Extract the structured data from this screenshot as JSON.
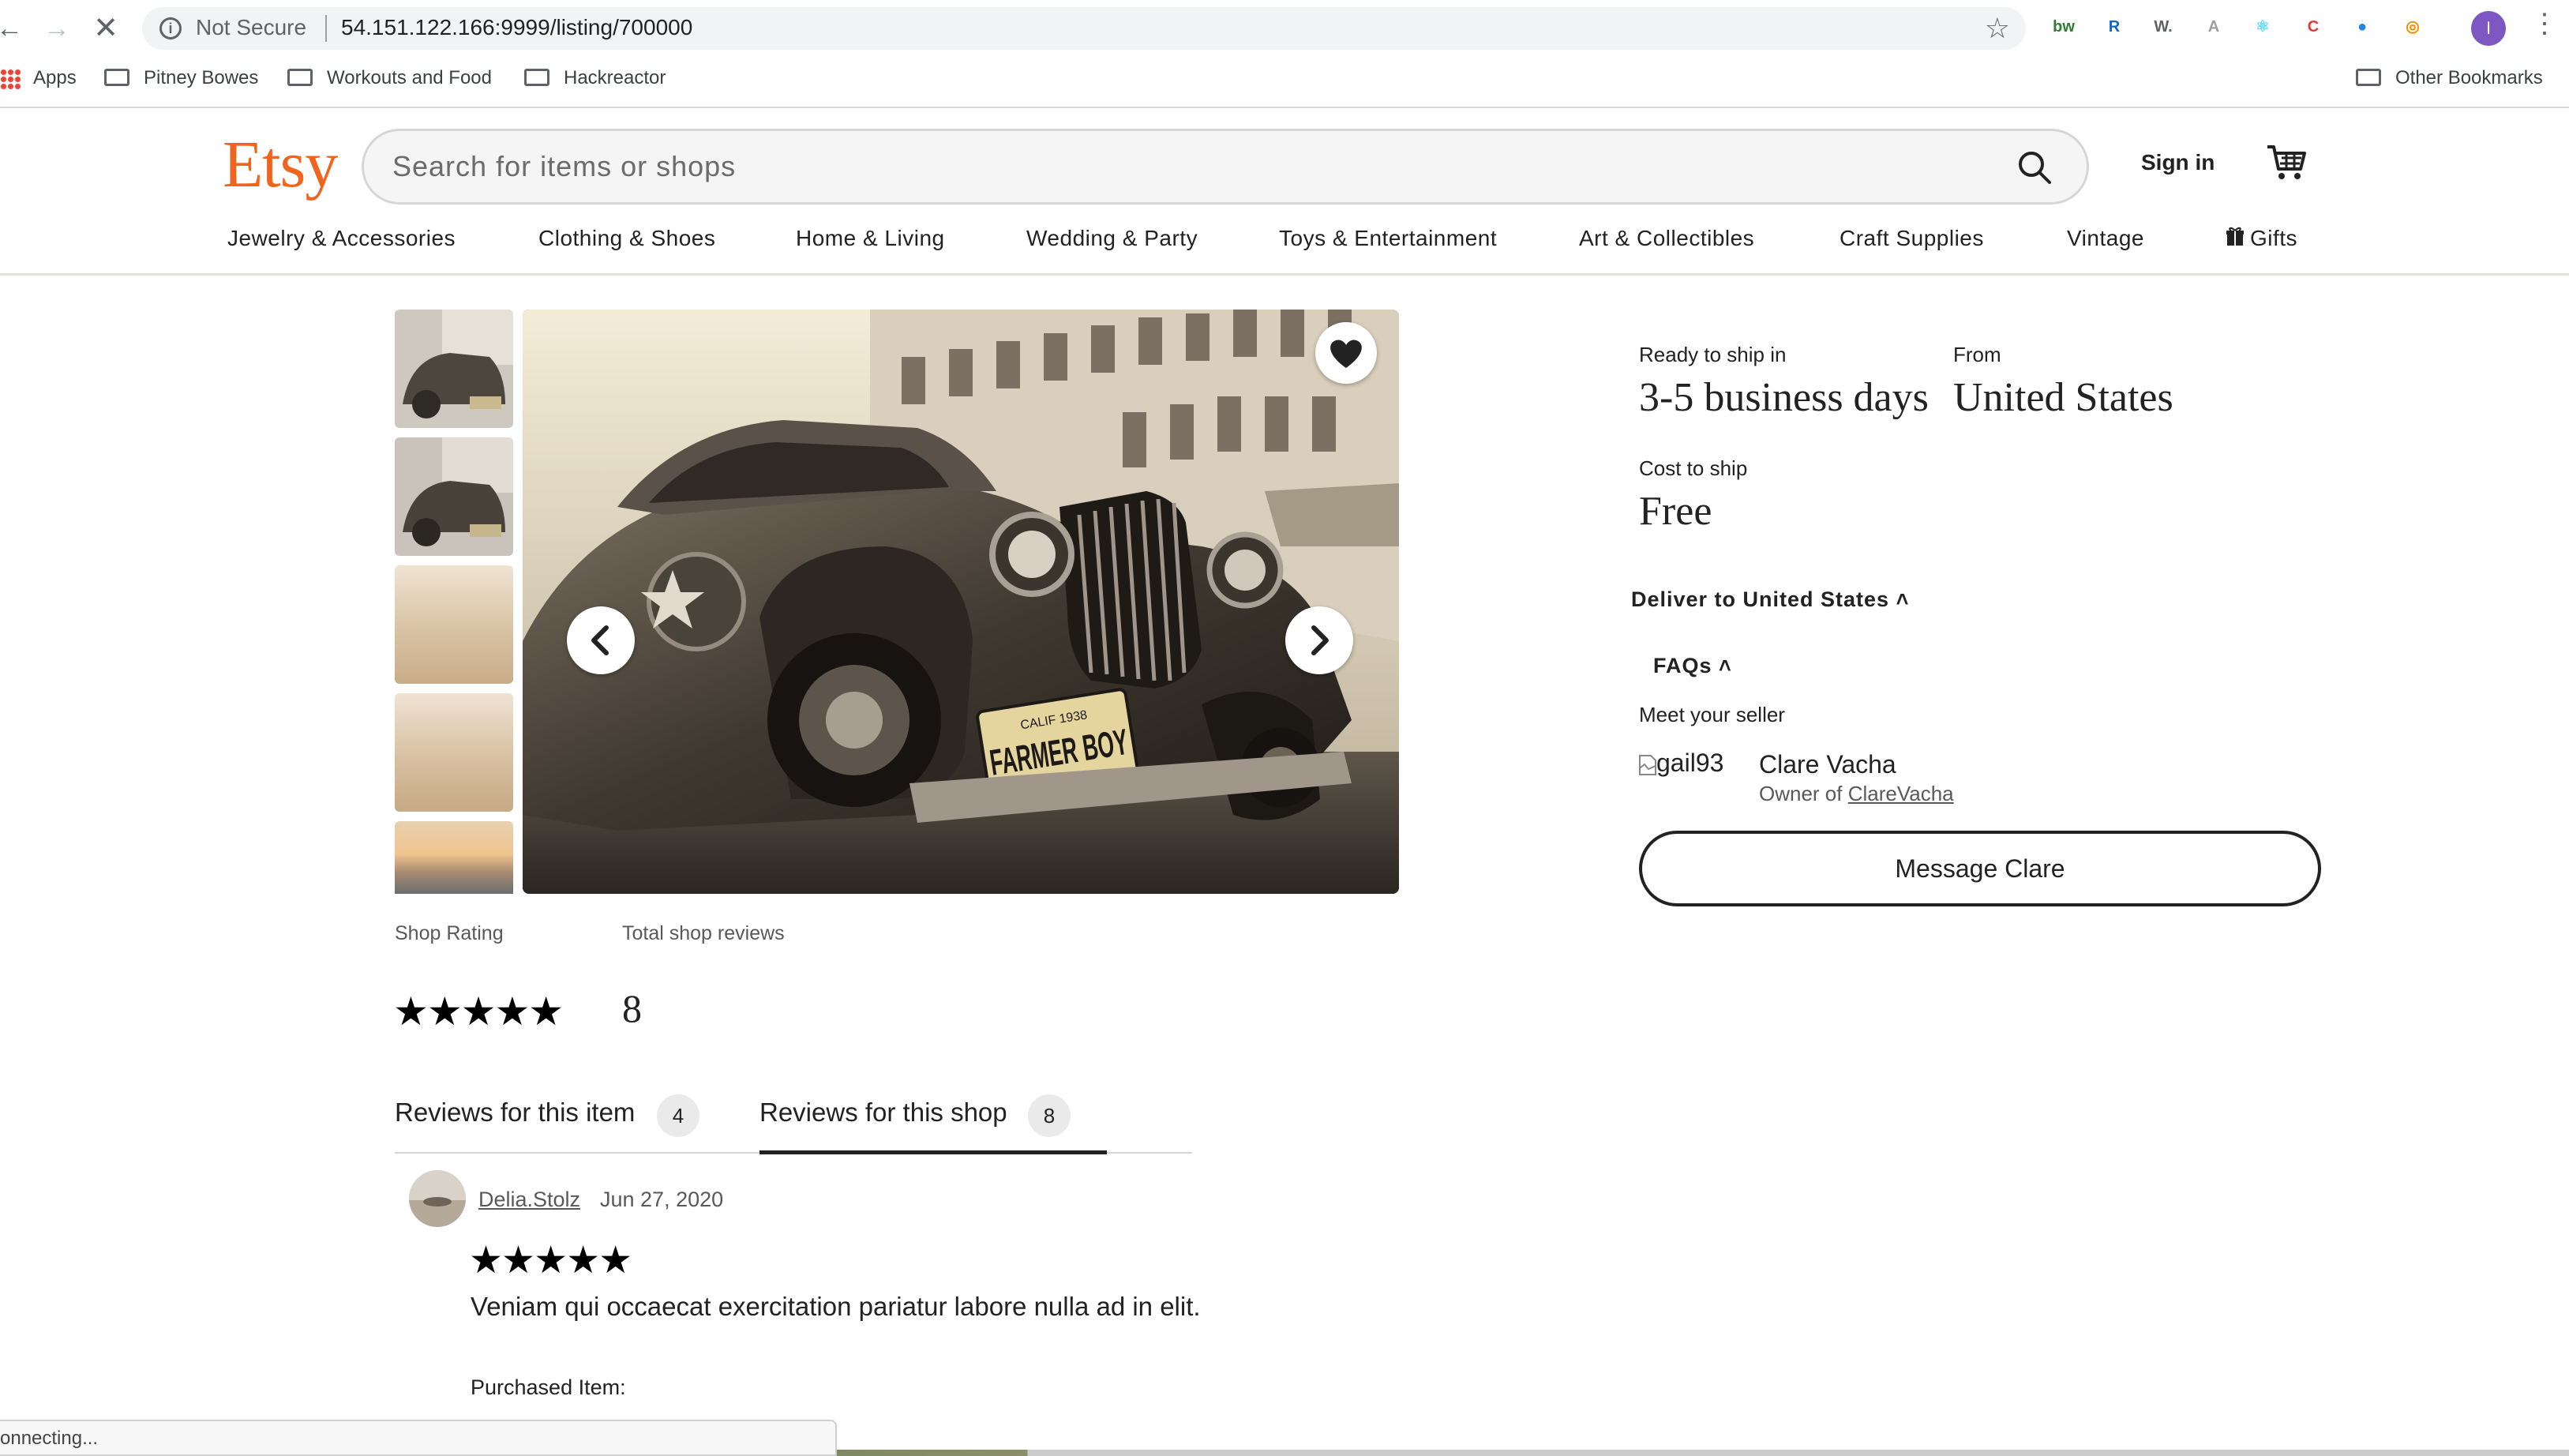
{
  "browser": {
    "security_label": "Not Secure",
    "url": "54.151.122.166:9999/listing/700000",
    "profile_initial": "I",
    "extensions": [
      {
        "name": "bw-extension-icon",
        "label": "bw",
        "color": "#2e7d32"
      },
      {
        "name": "r-extension-icon",
        "label": "R",
        "color": "#1565c0"
      },
      {
        "name": "w-extension-icon",
        "label": "W.",
        "color": "#5f6368"
      },
      {
        "name": "puzzle-extension-icon",
        "label": "A",
        "color": "#9e9e9e"
      },
      {
        "name": "react-devtools-icon",
        "label": "⚛",
        "color": "#61dafb"
      },
      {
        "name": "c-extension-icon",
        "label": "C",
        "color": "#e53935"
      },
      {
        "name": "circle-extension-icon",
        "label": "●",
        "color": "#1e88e5"
      },
      {
        "name": "fingerprint-extension-icon",
        "label": "◎",
        "color": "#fb8c00"
      }
    ],
    "bookmarks": {
      "apps": "Apps",
      "items": [
        "Pitney Bowes",
        "Workouts and Food",
        "Hackreactor"
      ],
      "other": "Other Bookmarks"
    },
    "status": "onnecting..."
  },
  "header": {
    "logo": "Etsy",
    "search_placeholder": "Search for items or shops",
    "sign_in": "Sign in",
    "categories": [
      "Jewelry & Accessories",
      "Clothing & Shoes",
      "Home & Living",
      "Wedding & Party",
      "Toys & Entertainment",
      "Art & Collectibles",
      "Craft Supplies",
      "Vintage",
      "Gifts"
    ]
  },
  "gallery": {
    "thumbnail_count": 5,
    "main_image_plate": "FARMER BOY",
    "main_image_plate_top": "CALIF 1938"
  },
  "shop_rating": {
    "rating_label": "Shop Rating",
    "reviews_label": "Total shop reviews",
    "stars": 5,
    "total_reviews": "8"
  },
  "reviews": {
    "tabs": [
      {
        "label": "Reviews for this item",
        "count": "4"
      },
      {
        "label": "Reviews for this shop",
        "count": "8"
      }
    ],
    "active_tab": 1,
    "items": [
      {
        "author": "Delia.Stolz",
        "date": "Jun 27, 2020",
        "stars": 5,
        "text": "Veniam qui occaecat exercitation pariatur labore nulla ad in elit.",
        "purchased_label": "Purchased Item:"
      }
    ]
  },
  "shipping": {
    "ready_label": "Ready to ship in",
    "ready_value": "3-5 business days",
    "from_label": "From",
    "from_value": "United States",
    "cost_label": "Cost to ship",
    "cost_value": "Free",
    "deliver_to": "Deliver to United States",
    "faqs": "FAQs"
  },
  "seller": {
    "heading": "Meet your seller",
    "image_alt": "gail93",
    "name": "Clare Vacha",
    "owner_prefix": "Owner of ",
    "shop_name": "ClareVacha",
    "message_button": "Message Clare"
  }
}
